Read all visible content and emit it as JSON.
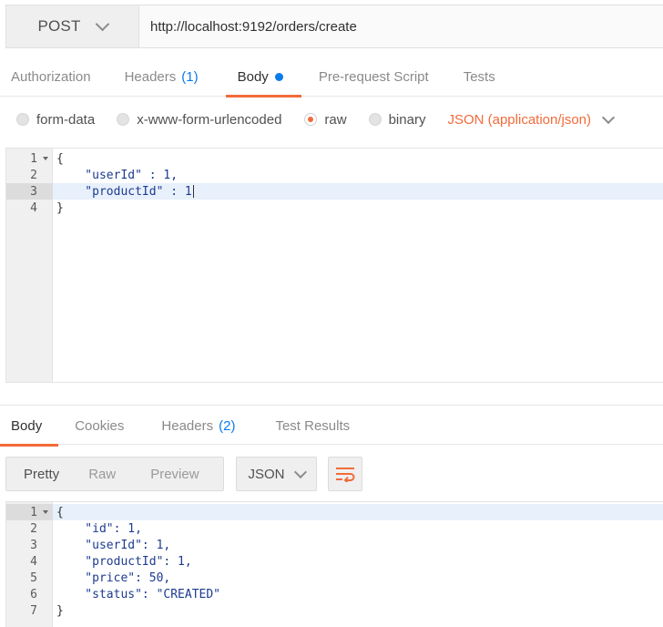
{
  "request": {
    "method": "POST",
    "url": "http://localhost:9192/orders/create"
  },
  "request_tabs": [
    {
      "label": "Authorization"
    },
    {
      "label": "Headers",
      "count": "(1)"
    },
    {
      "label": "Body",
      "active": true
    },
    {
      "label": "Pre-request Script"
    },
    {
      "label": "Tests"
    }
  ],
  "body_types": [
    {
      "label": "form-data",
      "checked": false
    },
    {
      "label": "x-www-form-urlencoded",
      "checked": false
    },
    {
      "label": "raw",
      "checked": true
    },
    {
      "label": "binary",
      "checked": false
    }
  ],
  "content_type": "JSON (application/json)",
  "request_body_lines": [
    {
      "num": "1",
      "text": "{"
    },
    {
      "num": "2",
      "text": "    \"userId\" : 1,"
    },
    {
      "num": "3",
      "text": "    \"productId\" : 1"
    },
    {
      "num": "4",
      "text": "}"
    }
  ],
  "response_tabs": [
    {
      "label": "Body",
      "active": true
    },
    {
      "label": "Cookies"
    },
    {
      "label": "Headers",
      "count": "(2)"
    },
    {
      "label": "Test Results"
    }
  ],
  "view_modes": {
    "pretty": "Pretty",
    "raw": "Raw",
    "preview": "Preview"
  },
  "format": "JSON",
  "response_body_lines": [
    {
      "num": "1",
      "text": "{"
    },
    {
      "num": "2",
      "text": "    \"id\": 1,"
    },
    {
      "num": "3",
      "text": "    \"userId\": 1,"
    },
    {
      "num": "4",
      "text": "    \"productId\": 1,"
    },
    {
      "num": "5",
      "text": "    \"price\": 50,"
    },
    {
      "num": "6",
      "text": "    \"status\": \"CREATED\""
    },
    {
      "num": "7",
      "text": "}"
    }
  ],
  "colors": {
    "accent": "#f26b3a",
    "link": "#097bed"
  },
  "icons": [
    "chevron-down-icon",
    "radio-icon",
    "fold-arrow-icon",
    "wrap-lines-icon"
  ]
}
